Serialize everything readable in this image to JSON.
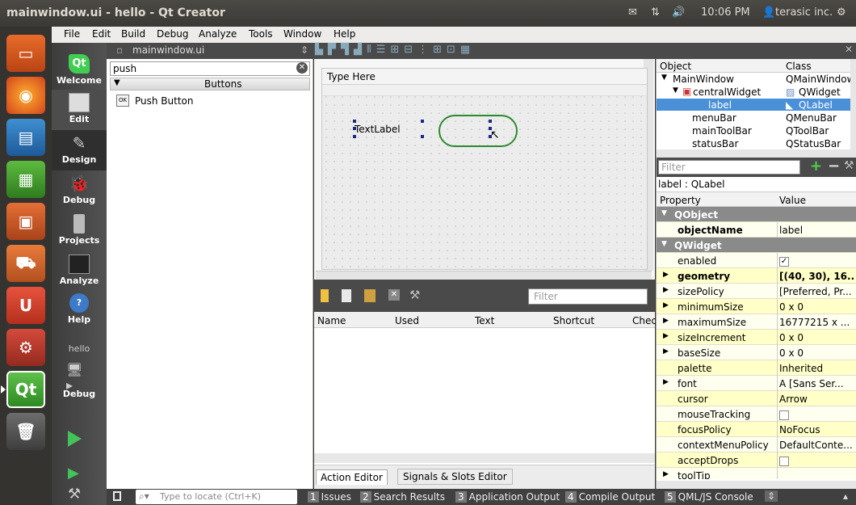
{
  "window": {
    "title": "mainwindow.ui - hello - Qt Creator"
  },
  "indicators": {
    "time": "10:06 PM",
    "user": "terasic inc."
  },
  "menu": [
    "File",
    "Edit",
    "Build",
    "Debug",
    "Analyze",
    "Tools",
    "Window",
    "Help"
  ],
  "modes": [
    "Welcome",
    "Edit",
    "Design",
    "Debug",
    "Projects",
    "Analyze",
    "Help"
  ],
  "project": {
    "name": "hello",
    "kit_mode": "Debug"
  },
  "design_toolbar": {
    "file": "mainwindow.ui"
  },
  "widget_box": {
    "filter_value": "push",
    "category": "Buttons",
    "items": [
      "Push Button"
    ]
  },
  "form": {
    "menu_placeholder": "Type Here",
    "label_text": "TextLabel"
  },
  "action_editor": {
    "filter_placeholder": "Filter",
    "columns": [
      "Name",
      "Used",
      "Text",
      "Shortcut",
      "Chec"
    ],
    "tabs": [
      "Action Editor",
      "Signals & Slots Editor"
    ]
  },
  "object_inspector": {
    "columns": [
      "Object",
      "Class"
    ],
    "rows": [
      {
        "obj": "MainWindow",
        "cls": "QMainWindow"
      },
      {
        "obj": "centralWidget",
        "cls": "QWidget"
      },
      {
        "obj": "label",
        "cls": "QLabel"
      },
      {
        "obj": "menuBar",
        "cls": "QMenuBar"
      },
      {
        "obj": "mainToolBar",
        "cls": "QToolBar"
      },
      {
        "obj": "statusBar",
        "cls": "QStatusBar"
      }
    ]
  },
  "property_editor": {
    "filter_placeholder": "Filter",
    "context": "label : QLabel",
    "columns": [
      "Property",
      "Value"
    ],
    "rows": [
      {
        "name": "QObject",
        "value": "",
        "kind": "section"
      },
      {
        "name": "objectName",
        "value": "label",
        "kind": "bold"
      },
      {
        "name": "QWidget",
        "value": "",
        "kind": "section"
      },
      {
        "name": "enabled",
        "value": "✓",
        "kind": "check"
      },
      {
        "name": "geometry",
        "value": "[(40, 30), 16...",
        "kind": "boldexp"
      },
      {
        "name": "sizePolicy",
        "value": "[Preferred, Pr...",
        "kind": "exp"
      },
      {
        "name": "minimumSize",
        "value": "0 x 0",
        "kind": "exp"
      },
      {
        "name": "maximumSize",
        "value": "16777215 x ...",
        "kind": "exp"
      },
      {
        "name": "sizeIncrement",
        "value": "0 x 0",
        "kind": "exp"
      },
      {
        "name": "baseSize",
        "value": "0 x 0",
        "kind": "exp"
      },
      {
        "name": "palette",
        "value": "Inherited",
        "kind": "plain"
      },
      {
        "name": "font",
        "value": "A  [Sans Ser...",
        "kind": "exp"
      },
      {
        "name": "cursor",
        "value": "Arrow",
        "kind": "plain"
      },
      {
        "name": "mouseTracking",
        "value": "",
        "kind": "check"
      },
      {
        "name": "focusPolicy",
        "value": "NoFocus",
        "kind": "plain"
      },
      {
        "name": "contextMenuPolicy",
        "value": "DefaultConte...",
        "kind": "plain"
      },
      {
        "name": "acceptDrops",
        "value": "",
        "kind": "check"
      },
      {
        "name": "toolTip",
        "value": "",
        "kind": "exp"
      }
    ]
  },
  "statusbar": {
    "locate_placeholder": "Type to locate (Ctrl+K)",
    "panes": [
      {
        "num": "1",
        "label": "Issues"
      },
      {
        "num": "2",
        "label": "Search Results"
      },
      {
        "num": "3",
        "label": "Application Output"
      },
      {
        "num": "4",
        "label": "Compile Output"
      },
      {
        "num": "5",
        "label": "QML/JS Console"
      }
    ]
  },
  "colors": {
    "accent_selection": "#4a90d9",
    "property_row": "#ffffc8",
    "section": "#8a8a8a",
    "qt_green": "#41cd52"
  }
}
